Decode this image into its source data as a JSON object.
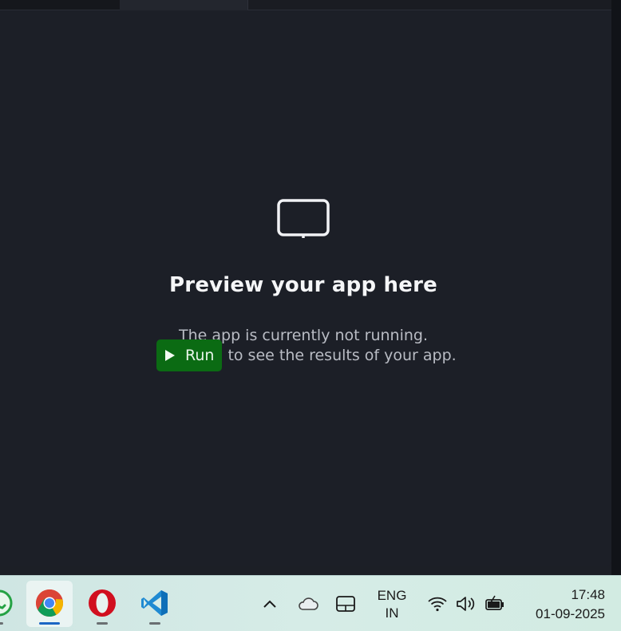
{
  "preview": {
    "icon": "monitor-icon",
    "title": "Preview your app here",
    "line1": "The app is currently not running.",
    "run_label": "Run",
    "line2_rest": "to see the results of your app.",
    "run_color": "#0b6b13"
  },
  "taskbar": {
    "apps": [
      {
        "name": "whatsapp",
        "icon": "whatsapp-icon"
      },
      {
        "name": "chrome",
        "icon": "chrome-icon",
        "active": true
      },
      {
        "name": "opera",
        "icon": "opera-icon"
      },
      {
        "name": "vscode",
        "icon": "vscode-icon"
      }
    ],
    "tray": {
      "chevron": "chevron-up-icon",
      "onedrive": "cloud-icon",
      "touchpad": "touchpad-icon",
      "lang_line1": "ENG",
      "lang_line2": "IN",
      "wifi": "wifi-icon",
      "volume": "speaker-icon",
      "battery": "battery-charging-icon"
    },
    "clock": {
      "time": "17:48",
      "date": "01-09-2025"
    }
  }
}
